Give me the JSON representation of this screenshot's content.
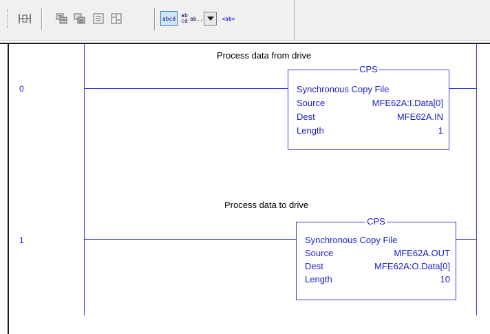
{
  "toolbar": {
    "buttons": [
      {
        "name": "insert-rung-icon",
        "glyph": "⍂"
      },
      {
        "name": "insert-branch-icon",
        "glyph": "⊞"
      },
      {
        "name": "insert-branch-level-icon",
        "glyph": "⊟"
      },
      {
        "name": "insert-xic-icon",
        "glyph": "⊡"
      },
      {
        "name": "insert-xio-icon",
        "glyph": "⊠"
      }
    ],
    "abcd_label": "abcd",
    "abcd_stack_top": "ab",
    "abcd_stack_bottom": "cd",
    "ab_dropdown_label": "ab...",
    "ab_tag_label": "<ab>"
  },
  "rungs": [
    {
      "number": "0",
      "comment": "Process data from drive",
      "instruction": {
        "mnemonic": "CPS",
        "title": "Synchronous Copy File",
        "source_label": "Source",
        "source_value": "MFE62A:I.Data[0]",
        "dest_label": "Dest",
        "dest_value": "MFE62A.IN",
        "length_label": "Length",
        "length_value": "1"
      }
    },
    {
      "number": "1",
      "comment": "Process data to drive",
      "instruction": {
        "mnemonic": "CPS",
        "title": "Synchronous Copy File",
        "source_label": "Source",
        "source_value": "MFE62A.OUT",
        "dest_label": "Dest",
        "dest_value": "MFE62A:O.Data[0]",
        "length_label": "Length",
        "length_value": "10"
      }
    }
  ],
  "colors": {
    "ladder_blue": "#3a3ad8",
    "text_blue": "#1b1bd1",
    "toolbar_bg": "#f0f0f0"
  }
}
